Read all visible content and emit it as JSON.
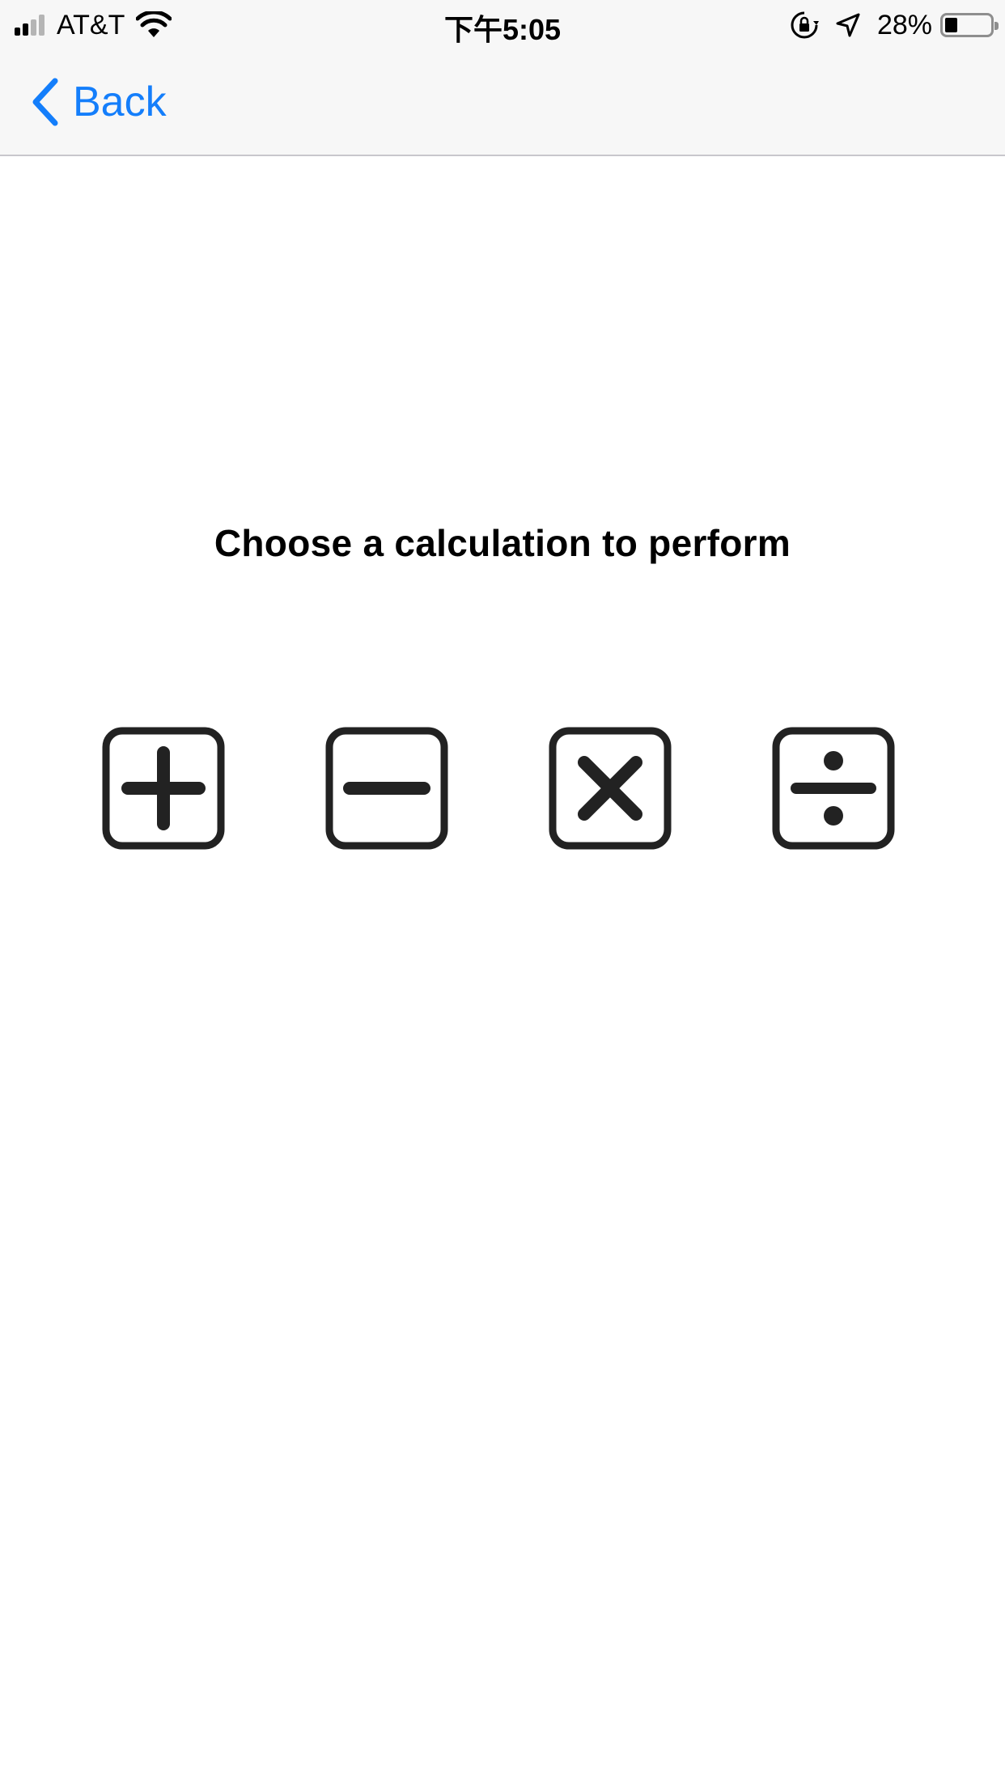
{
  "status_bar": {
    "carrier": "AT&T",
    "time": "下午5:05",
    "battery_percent": "28%",
    "battery_level": 0.28,
    "signal_bars_active": 2,
    "signal_bars_total": 4,
    "icons": [
      "signal-icon",
      "wifi-icon",
      "orientation-lock-icon",
      "location-icon",
      "battery-icon"
    ]
  },
  "nav": {
    "back_label": "Back",
    "accent_color": "#147efb"
  },
  "main": {
    "title": "Choose a calculation to perform",
    "operations": [
      {
        "name": "addition",
        "icon": "plus-icon"
      },
      {
        "name": "subtraction",
        "icon": "minus-icon"
      },
      {
        "name": "multiplication",
        "icon": "multiply-icon"
      },
      {
        "name": "division",
        "icon": "divide-icon"
      }
    ]
  }
}
